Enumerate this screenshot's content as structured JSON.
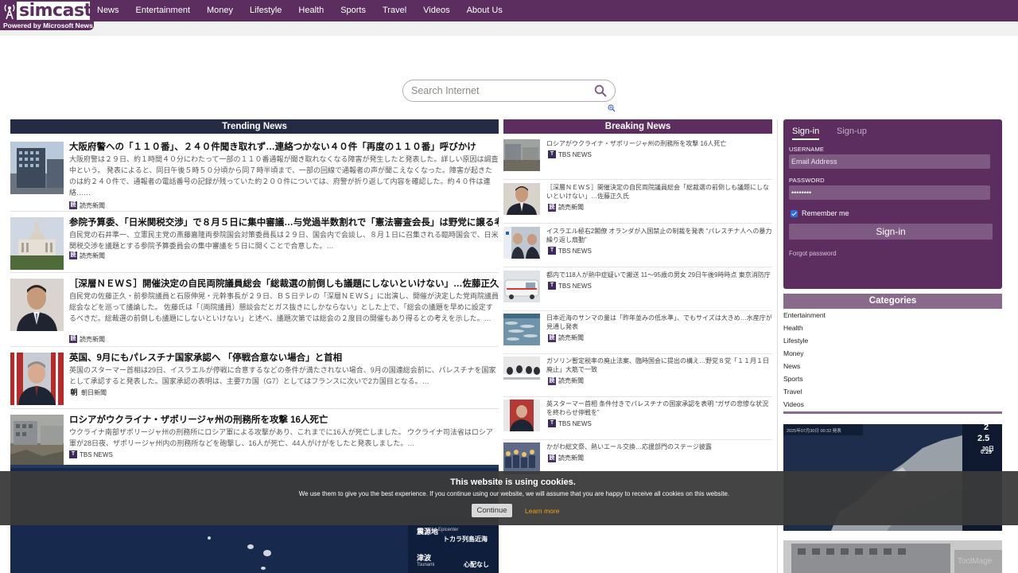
{
  "brand": {
    "name": "simcast",
    "tagline": "Powered by Microsoft News",
    "color": "#5b2e5f"
  },
  "nav": {
    "items": [
      "News",
      "Entertainment",
      "Money",
      "Lifestyle",
      "Health",
      "Sports",
      "Travel",
      "Videos",
      "About Us"
    ]
  },
  "search": {
    "placeholder": "Search Internet",
    "icon": "search-icon"
  },
  "trending": {
    "heading": "Trending News",
    "items": [
      {
        "title": "大阪府警への「１１０番」、２４０件聞き取れず…連絡つかない４０件「再度の１１０番」呼びかけ",
        "body": "大阪府警は２９日、約１時間４０分にわたって一部の１１０番通報が聞き取れなくなる障害が発生したと発表した。詳しい原因は調査中という。 発表によると、同日午後５時５０分頃から同７時半頃まで、一部の回線で通報者の声が聞こえなくなった。障害が起きたのは約２４０件で、通報者の電話番号の記録が残っていた約２００件については、府警が折り返して内容を確認した。約４０件は連絡……",
        "source": "読売新聞",
        "source_mark": "読"
      },
      {
        "title": "参院予算委、「日米関税交渉」で８月５日に集中審議…与党過半数割れで「憲法審査会長」は野党に譲る考え",
        "body": "自民党の石井準一、立憲民主党の斎藤嘉隆両参院国会対策委員長は２９日、国会内で会談し、８月１日に召集される臨時国会で、日米関税交渉を議題とする参院予算委員会の集中審議を５日に開くことで合意した。…",
        "source": "読売新聞",
        "source_mark": "読"
      },
      {
        "title": "［深層ＮＥＷＳ］開催決定の自民両院議員総会「総裁選の前倒しも議題にしないといけない」…佐藤正久氏",
        "body": "自民党の佐藤正久・前参院議員と石原伸晃・元幹事長が２９日、ＢＳ日テレの「深層ＮＥＷＳ」に出演し、開催が決定した党両院議員総会などを巡って議論した。 佐藤氏は「（両院議員）懇談会だとガス抜きにしかならない」とした上で、「総会の議題を早めに設定するべきだ。総裁選の前倒しも議題にしないといけない」と述べ、議題次第では総会の２度目の開催もあり得るとの考えを示した。…",
        "source": "読売新聞",
        "source_mark": "読"
      },
      {
        "title": "英国、9月にもパレスチナ国家承認へ 「停戦合意ない場合」と首相",
        "body": "英国のスターマー首相は29日、イスラエルが停戦に合意するなどの条件が満たされない場合、9月の国連総会前に、パレスチナを国家として承認すると発表した。国家承認の表明は、主要7カ国（G7）としてはフランスに次いで2カ国目となる。…",
        "source": "朝日新聞",
        "source_mark": "朝"
      },
      {
        "title": "ロシアがウクライナ・ザポリージャ州の刑務所を攻撃 16人死亡",
        "body": "ウクライナ南部ザポリージャ州の刑務所にロシア軍による攻撃があり、これまでに16人が死亡しました。 ウクライナ司法省はロシア軍が28日夜、ザポリージャ州内の刑務所などを砲撃し、16人が死亡、44人がけがをしたと発表しました。…",
        "source": "TBS NEWS",
        "source_mark": "T"
      }
    ]
  },
  "breaking": {
    "heading": "Breaking News",
    "items": [
      {
        "title": "ロシアがウクライナ・ザポリージャ州の刑務所を攻撃 16人死亡",
        "source": "TBS NEWS",
        "source_mark": "T"
      },
      {
        "title": "［深層ＮＥＷＳ］開催決定の自民両院議員総会「総裁選の前倒しも議題にしないといけない」…佐藤正久氏",
        "source": "読売新聞",
        "source_mark": "読"
      },
      {
        "title": "イスラエル極右2閣僚 オランダが入国禁止の制裁を発表 “パレスチナ人への暴力繰り返し扇動”",
        "source": "TBS NEWS",
        "source_mark": "T"
      },
      {
        "title": "都内で118人が熱中症疑いで搬送 11～95歳の男女 29日午後9時時点 東京消防庁",
        "source": "TBS NEWS",
        "source_mark": "T"
      },
      {
        "title": "日本近海のサンマの量は「昨年並みの低水準」、でもサイズは大きめ…水産庁が見通し発表",
        "source": "読売新聞",
        "source_mark": "読"
      },
      {
        "title": "ガソリン暫定税率の廃止法案、臨時国会に提出の構え…野党８党「１１月１日廃止」大筋で一致",
        "source": "読売新聞",
        "source_mark": "読"
      },
      {
        "title": "英スターマー首相 条件付きでパレスチナの国家承認を表明 “ガザの悲惨な状況を終わらせ停戦を”",
        "source": "TBS NEWS",
        "source_mark": "T"
      },
      {
        "title": "かがわ総文祭、熱いエール交換…応援部門のステージ披露",
        "source": "読売新聞",
        "source_mark": "読"
      }
    ]
  },
  "signin": {
    "tab_signin": "Sign-in",
    "tab_signup": "Sign-up",
    "username_label": "USERNAME",
    "username_placeholder": "Email Address",
    "password_label": "PASSWORD",
    "password_value": "••••••••",
    "remember_label": "Remember me",
    "button": "Sign-in",
    "forgot": "Forgot password"
  },
  "categories": {
    "heading": "Categories",
    "items": [
      "Entertainment",
      "Health",
      "Lifestyle",
      "Money",
      "News",
      "Sports",
      "Travel",
      "Videos"
    ]
  },
  "map_main": {
    "label_epicenter_jp": "震源地",
    "label_epicenter_en": "Epicenter",
    "epicenter_value": "トカラ列島近海",
    "label_tsunami_jp": "津波",
    "label_tsunami_en": "Tsunami",
    "tsunami_value": "心配なし"
  },
  "map_side": {
    "value_1": "2",
    "value_2": "2.5",
    "value_3": "30日",
    "value_4": "0:29",
    "header_text": "2025年07月30日 00:32 発表"
  },
  "cookie": {
    "title": "This website is using cookies.",
    "text": "We use them to give you the best experience. If you continue using our website, we will assume that you are happy to receive all cookies on this website.",
    "button": "Continue",
    "link": "Learn more"
  },
  "watermark": "ToolMage"
}
